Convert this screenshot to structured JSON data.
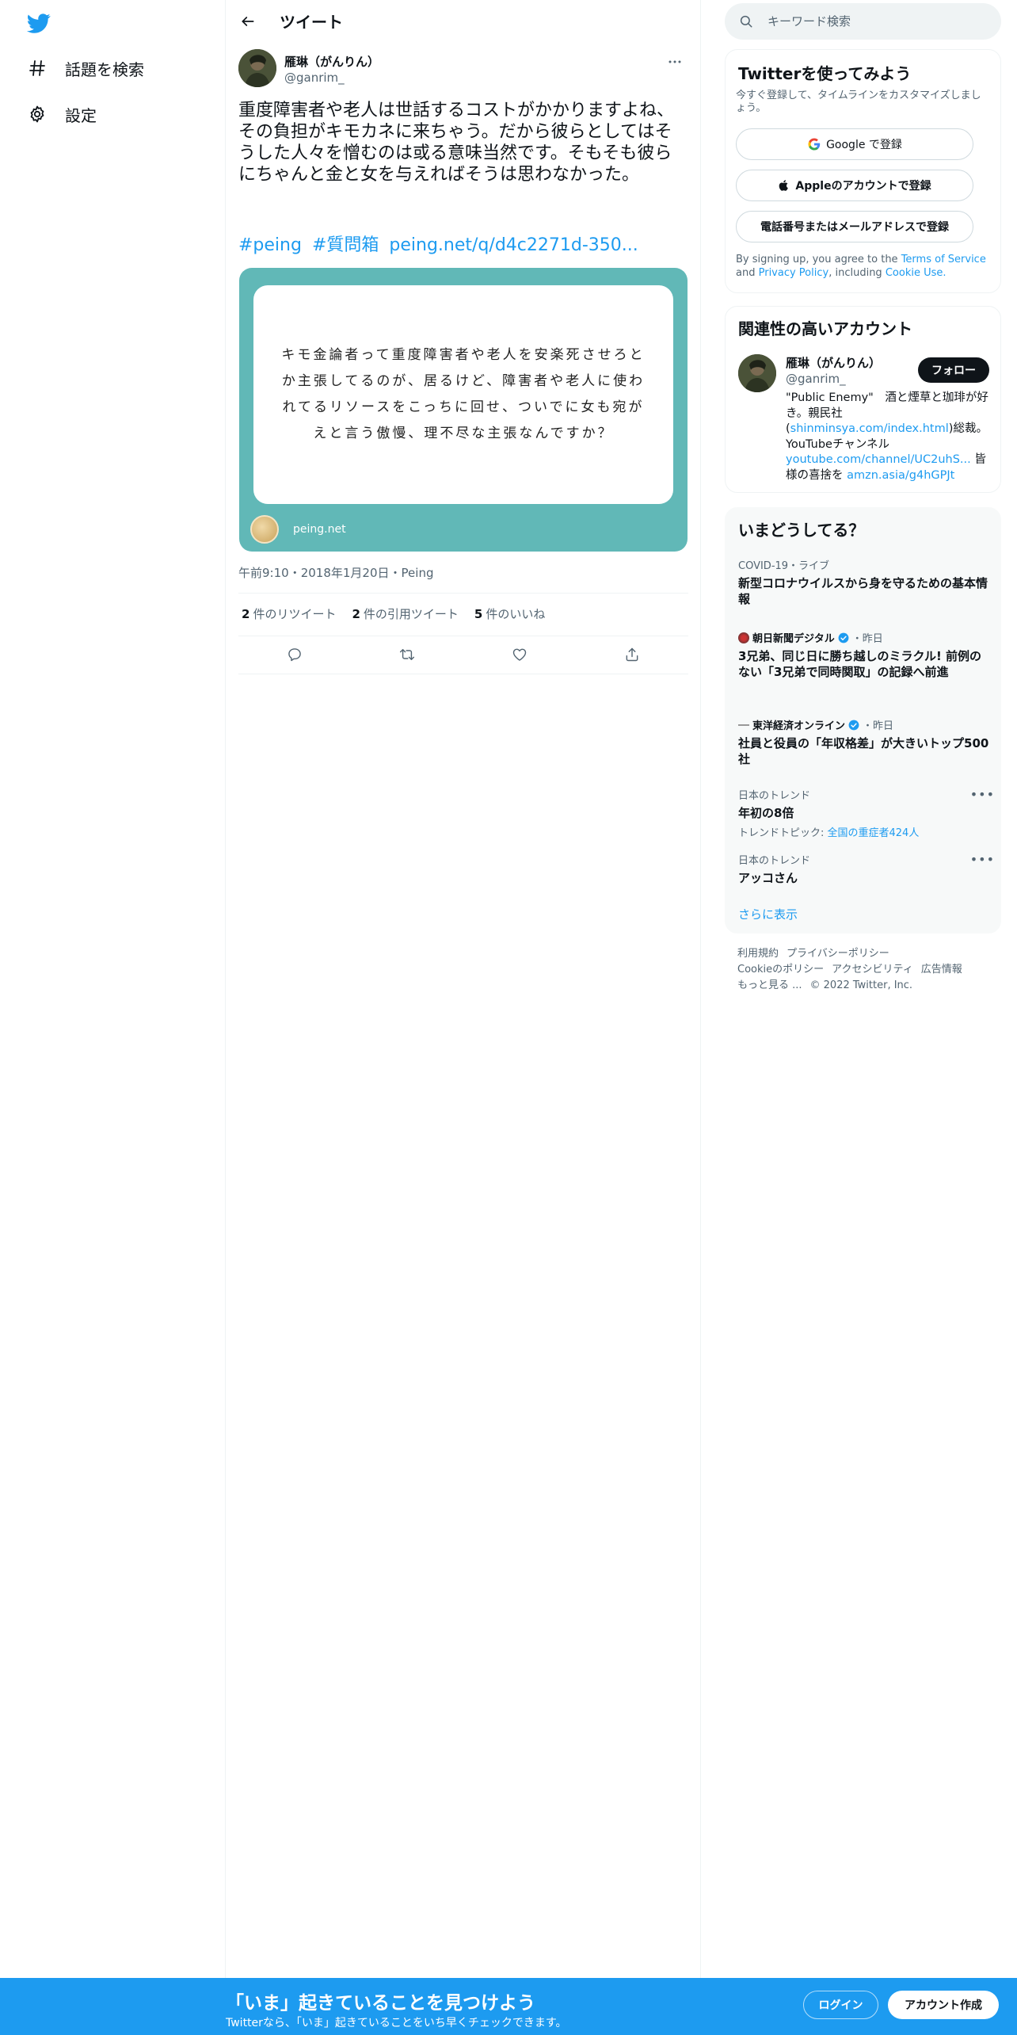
{
  "nav": {
    "items": [
      {
        "label": "話題を検索",
        "icon": "hashtag-icon"
      },
      {
        "label": "設定",
        "icon": "gear-icon"
      }
    ]
  },
  "header": {
    "title": "ツイート"
  },
  "tweet": {
    "author_name": "雁琳（がんりん）",
    "author_handle": "@ganrim_",
    "text": "重度障害者や老人は世話するコストがかかりますよね、その負担がキモカネに来ちゃう。だから彼らとしてはそうした人々を憎むのは或る意味当然です。そもそも彼らにちゃんと金と女を与えればそうは思わなかった。",
    "hashtag1": "#peing",
    "hashtag2": "#質問箱",
    "link": "peing.net/q/d4c2271d-350...",
    "card_text": "キモ金論者って重度障害者や老人を安楽死させろとか主張してるのが、居るけど、障害者や老人に使われてるリソースをこっちに回せ、ついでに女も宛がえと言う傲慢、理不尽な主張なんですか？",
    "card_domain": "peing.net",
    "time": "午前9:10",
    "date": "2018年1月20日",
    "source": "Peing",
    "retweets_count": "2",
    "retweets_label": "件のリツイート",
    "quotes_count": "2",
    "quotes_label": "件の引用ツイート",
    "likes_count": "5",
    "likes_label": "件のいいね"
  },
  "search": {
    "placeholder": "キーワード検索"
  },
  "signup": {
    "title": "Twitterを使ってみよう",
    "subtitle": "今すぐ登録して、タイムラインをカスタマイズしましょう。",
    "google_label": "Google で登録",
    "apple_label": "Appleのアカウントで登録",
    "phone_label": "電話番号またはメールアドレスで登録",
    "legal_prefix": "By signing up, you agree to the",
    "terms_link": "Terms of Service",
    "legal_and": "and",
    "privacy_link": "Privacy Policy",
    "legal_including": ", including",
    "cookie_link": "Cookie Use."
  },
  "related": {
    "title": "関連性の高いアカウント",
    "name": "雁琳（がんりん）",
    "handle": "@ganrim_",
    "follow_label": "フォロー",
    "bio_1": "\"Public Enemy\"　酒と煙草と珈琲が好き。親民社(",
    "bio_link1": "shinminsya.com/index.html",
    "bio_2": ")総裁。YouTubeチャンネル",
    "bio_link2": "youtube.com/channel/UC2uhS...",
    "bio_3": " 皆様の喜捨を ",
    "bio_link3": "amzn.asia/g4hGPJt"
  },
  "trends": {
    "title": "いまどうしてる？",
    "items": [
      {
        "meta": "COVID-19・ライブ",
        "title": "新型コロナウイルスから身を守るための基本情報"
      },
      {
        "source": "朝日新聞デジタル",
        "time": "・昨日",
        "title": "3兄弟、同じ日に勝ち越しのミラクル! 前例のない「3兄弟で同時関取」の記録へ前進"
      },
      {
        "source": "東洋経済オンライン",
        "time": "・昨日",
        "title": "社員と役員の「年収格差」が大きいトップ500社"
      },
      {
        "meta": "日本のトレンド",
        "title": "年初の8倍",
        "sub_prefix": "トレンドトピック: ",
        "sub_link": "全国の重症者424人"
      },
      {
        "meta": "日本のトレンド",
        "title": "アッコさん"
      }
    ],
    "show_more": "さらに表示"
  },
  "footer": {
    "links": [
      "利用規約",
      "プライバシーポリシー",
      "Cookieのポリシー",
      "アクセシビリティ",
      "広告情報",
      "もっと見る ..."
    ],
    "copyright": "© 2022 Twitter, Inc."
  },
  "bottombar": {
    "title": "「いま」起きていることを見つけよう",
    "subtitle": "Twitterなら、「いま」起きていることをいち早くチェックできます。",
    "login": "ログイン",
    "signup": "アカウント作成"
  },
  "colors": {
    "accent": "#1d9bf0",
    "card_bg": "#61b8b7",
    "text": "#0f1419",
    "muted": "#536471"
  }
}
